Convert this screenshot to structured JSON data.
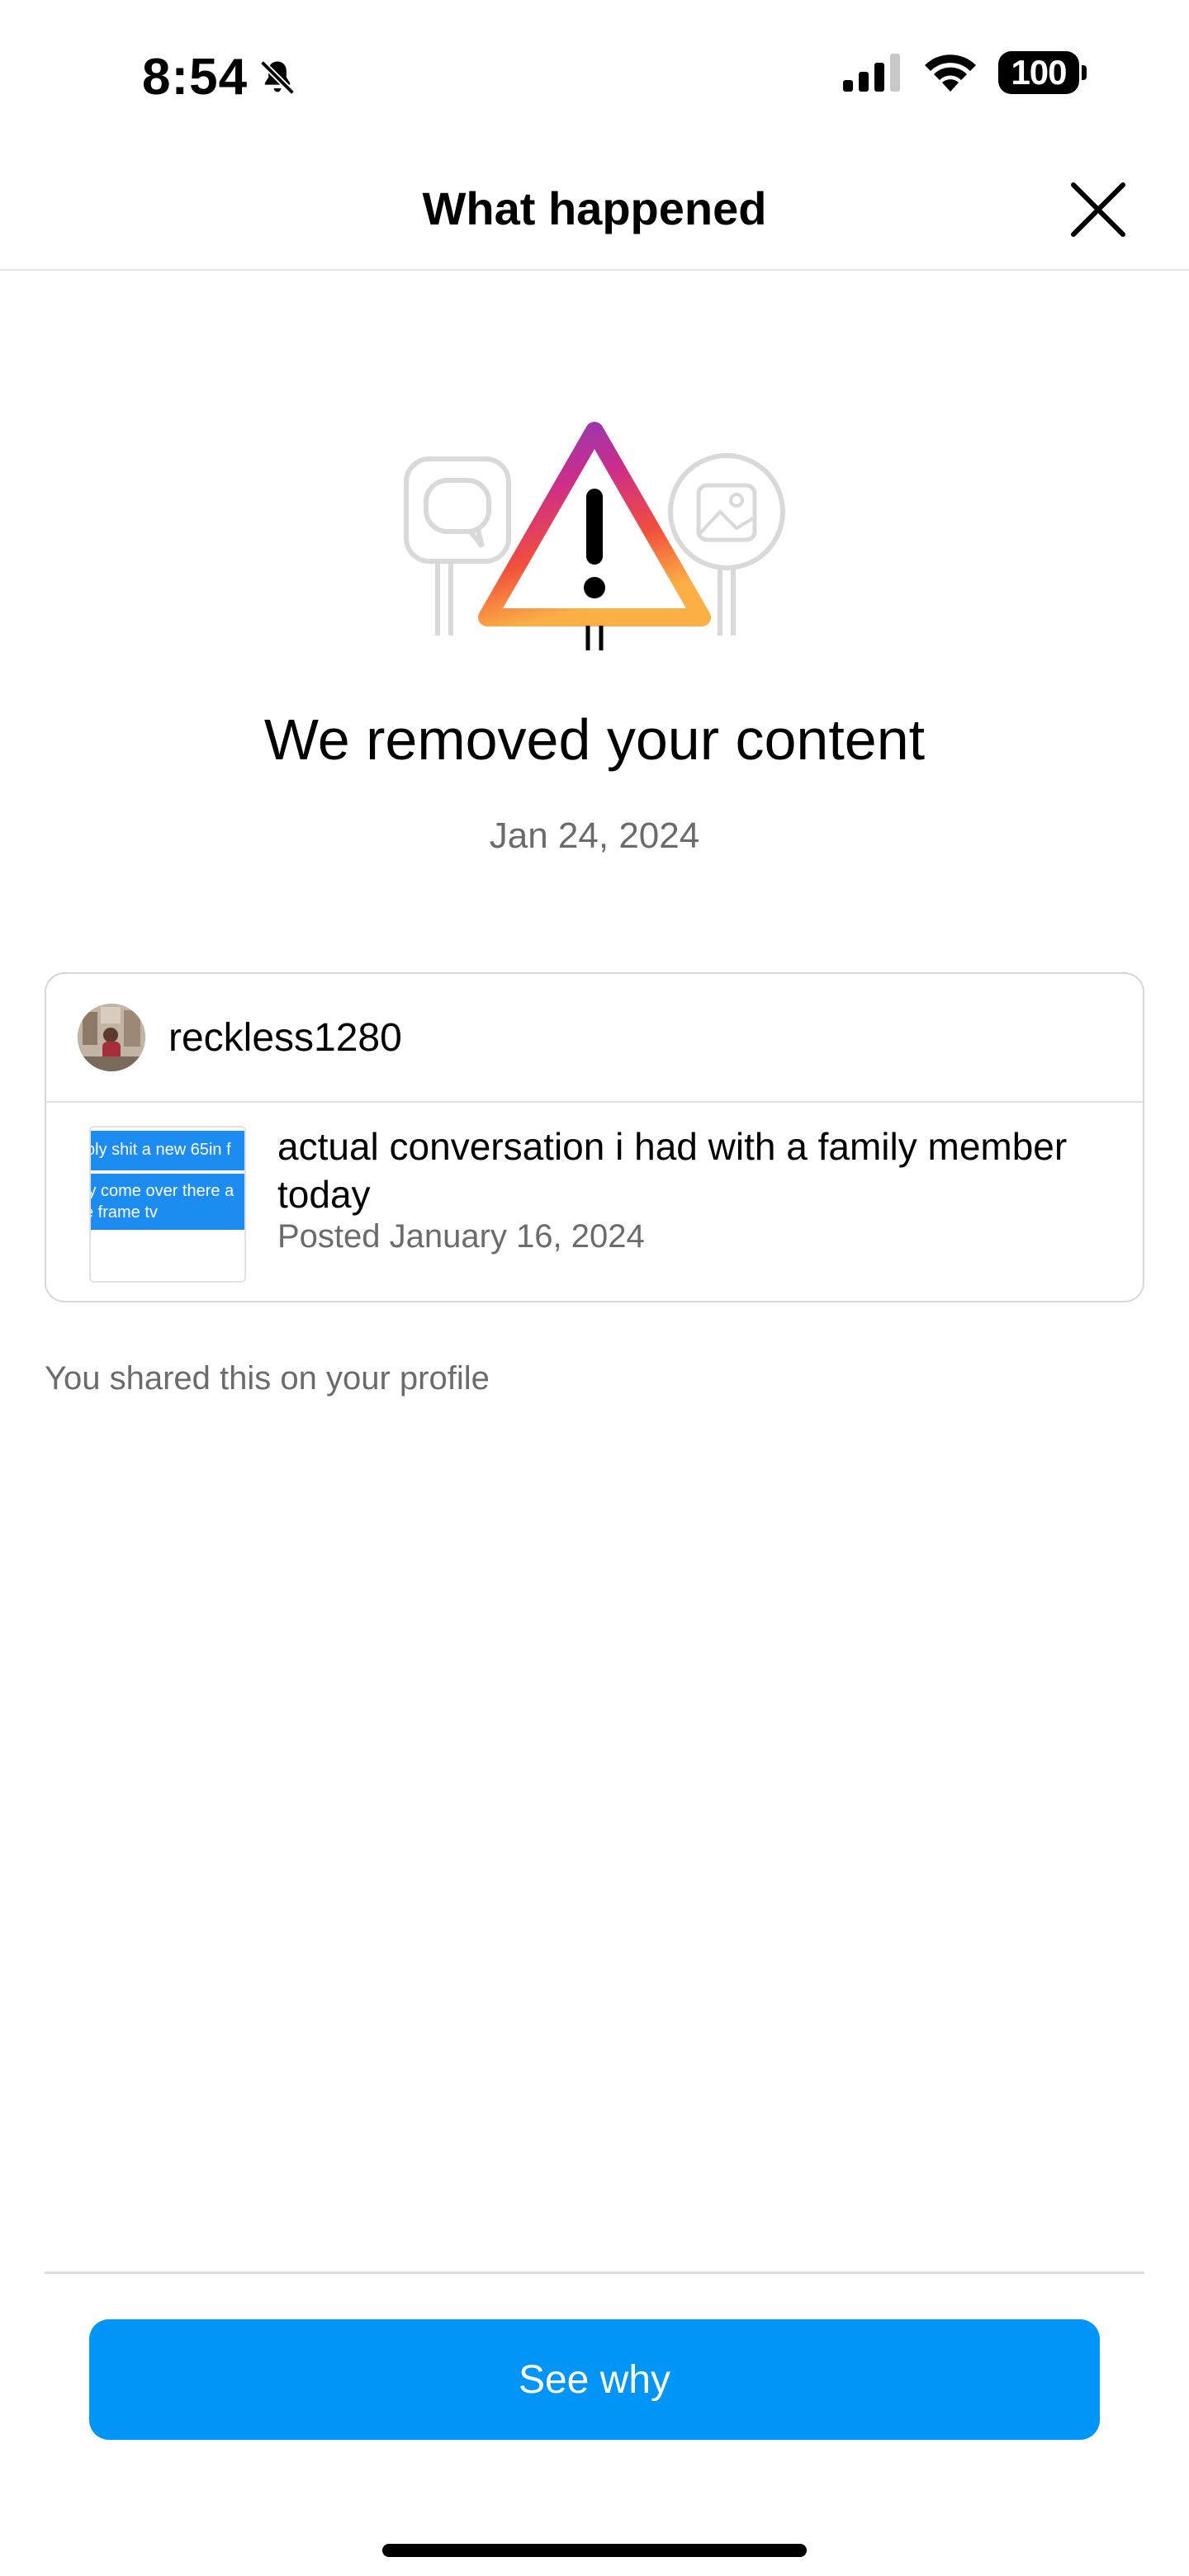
{
  "status_bar": {
    "time": "8:54",
    "battery": "100"
  },
  "header": {
    "title": "What happened"
  },
  "notice": {
    "headline": "We removed your content",
    "date": "Jan 24, 2024"
  },
  "card": {
    "username": "reckless1280",
    "post_text": "actual conversation i had with a family member today",
    "posted_date": "Posted January 16, 2024",
    "thumbnail_line_1": "bly shit a new 65in f",
    "thumbnail_line_2": "ly come over there a",
    "thumbnail_line_3": "e frame tv"
  },
  "note": "You shared this on your profile",
  "actions": {
    "see_why_label": "See why"
  },
  "colors": {
    "accent_blue": "#0095f6",
    "secondary_text": "#6b6b6b",
    "divider": "#dedede"
  },
  "icons": {
    "silent": "bell-slash-icon",
    "signal": "cellular-signal-icon",
    "wifi": "wifi-icon",
    "close": "close-icon",
    "warning": "warning-triangle-icon"
  }
}
